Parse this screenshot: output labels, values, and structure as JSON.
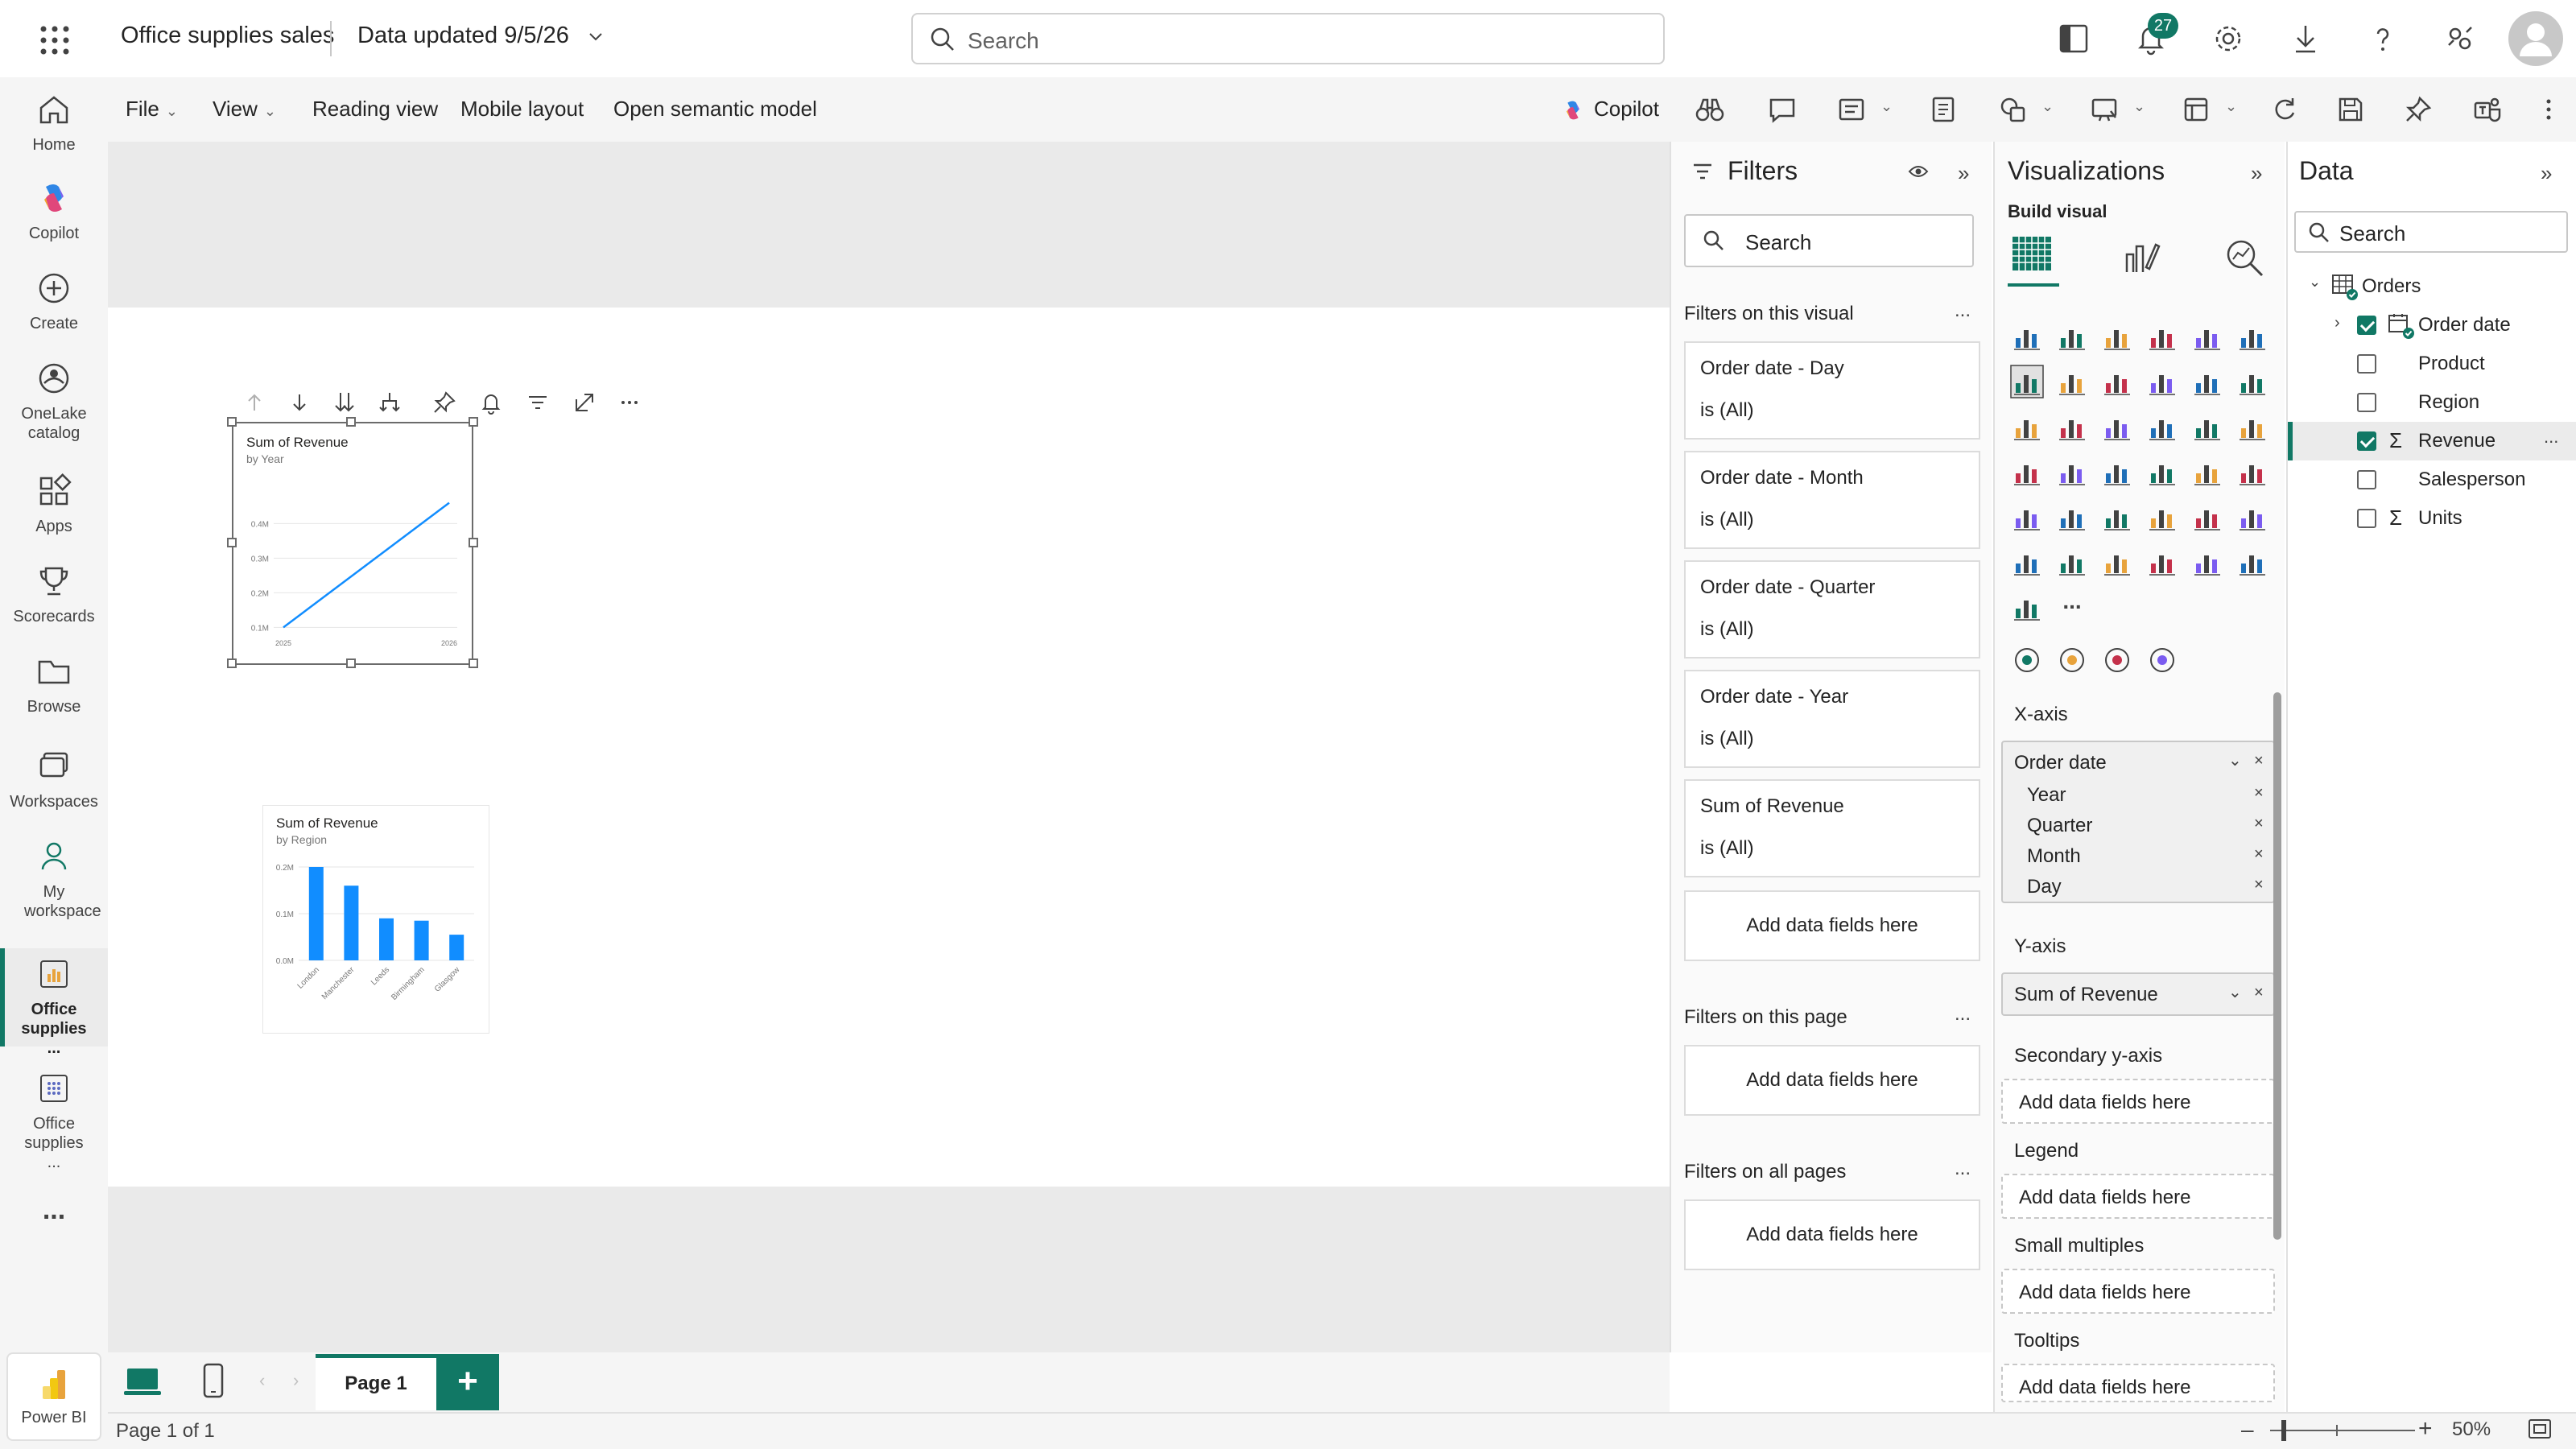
{
  "topbar": {
    "title": "Office supplies sales",
    "data_updated": "Data updated 9/5/26",
    "search_placeholder": "Search",
    "notification_count": "27"
  },
  "nav": {
    "items": [
      {
        "label": "Home"
      },
      {
        "label": "Copilot"
      },
      {
        "label": "Create"
      },
      {
        "label": "OneLake catalog"
      },
      {
        "label": "Apps"
      },
      {
        "label": "Scorecards"
      },
      {
        "label": "Browse"
      },
      {
        "label": "Workspaces"
      },
      {
        "label": "My workspace"
      },
      {
        "label": "Office supplies ..."
      },
      {
        "label": "Office supplies ..."
      }
    ],
    "more": "...",
    "brand": "Power BI"
  },
  "ribbon": {
    "file": "File",
    "view": "View",
    "reading_view": "Reading view",
    "mobile_layout": "Mobile layout",
    "open_semantic_model": "Open semantic model",
    "copilot": "Copilot"
  },
  "visuals": {
    "line": {
      "title": "Sum of Revenue",
      "subtitle": "by Year",
      "y_ticks": [
        "0.4M",
        "0.3M",
        "0.2M",
        "0.1M"
      ],
      "x_ticks": [
        "2025",
        "2026"
      ],
      "color": "#118DFF"
    },
    "bar": {
      "title": "Sum of Revenue",
      "subtitle": "by Region",
      "y_ticks": [
        "0.2M",
        "0.1M",
        "0.0M"
      ],
      "color": "#118DFF"
    }
  },
  "chart_data": [
    {
      "type": "line",
      "title": "Sum of Revenue",
      "subtitle": "by Year",
      "x": [
        "2025",
        "2026"
      ],
      "values": [
        0.1,
        0.46
      ],
      "ylim": [
        0.1,
        0.4
      ],
      "grid": true
    },
    {
      "type": "bar",
      "title": "Sum of Revenue",
      "subtitle": "by Region",
      "categories": [
        "London",
        "Manchester",
        "Leeds",
        "Birmingham",
        "Glasgow"
      ],
      "values": [
        0.2,
        0.16,
        0.09,
        0.085,
        0.055
      ],
      "ylim": [
        0,
        0.2
      ],
      "grid": true
    }
  ],
  "pages": {
    "tab": "Page 1",
    "add": "+",
    "status": "Page 1 of 1",
    "zoom": "50%"
  },
  "filters": {
    "title": "Filters",
    "search_placeholder": "Search",
    "on_visual_label": "Filters on this visual",
    "cards": [
      {
        "title": "Order date - Day",
        "value": "is (All)"
      },
      {
        "title": "Order date - Month",
        "value": "is (All)"
      },
      {
        "title": "Order date - Quarter",
        "value": "is (All)"
      },
      {
        "title": "Order date - Year",
        "value": "is (All)"
      },
      {
        "title": "Sum of Revenue",
        "value": "is (All)"
      }
    ],
    "add_fields": "Add data fields here",
    "on_page_label": "Filters on this page",
    "on_all_pages_label": "Filters on all pages",
    "dots": "..."
  },
  "visualizations": {
    "title": "Visualizations",
    "build_visual": "Build visual",
    "more": "...",
    "x_axis_label": "X-axis",
    "x_axis_field": "Order date",
    "x_axis_sub": [
      "Year",
      "Quarter",
      "Month",
      "Day"
    ],
    "y_axis_label": "Y-axis",
    "y_axis_field": "Sum of Revenue",
    "secondary_y_label": "Secondary y-axis",
    "legend_label": "Legend",
    "small_multiples_label": "Small multiples",
    "tooltips_label": "Tooltips",
    "add_fields": "Add data fields here"
  },
  "data": {
    "title": "Data",
    "search_placeholder": "Search",
    "table": "Orders",
    "fields": [
      {
        "name": "Order date",
        "checked": true
      },
      {
        "name": "Product",
        "checked": false
      },
      {
        "name": "Region",
        "checked": false
      },
      {
        "name": "Revenue",
        "checked": true
      },
      {
        "name": "Salesperson",
        "checked": false
      },
      {
        "name": "Units",
        "checked": false
      }
    ],
    "dots": "..."
  }
}
